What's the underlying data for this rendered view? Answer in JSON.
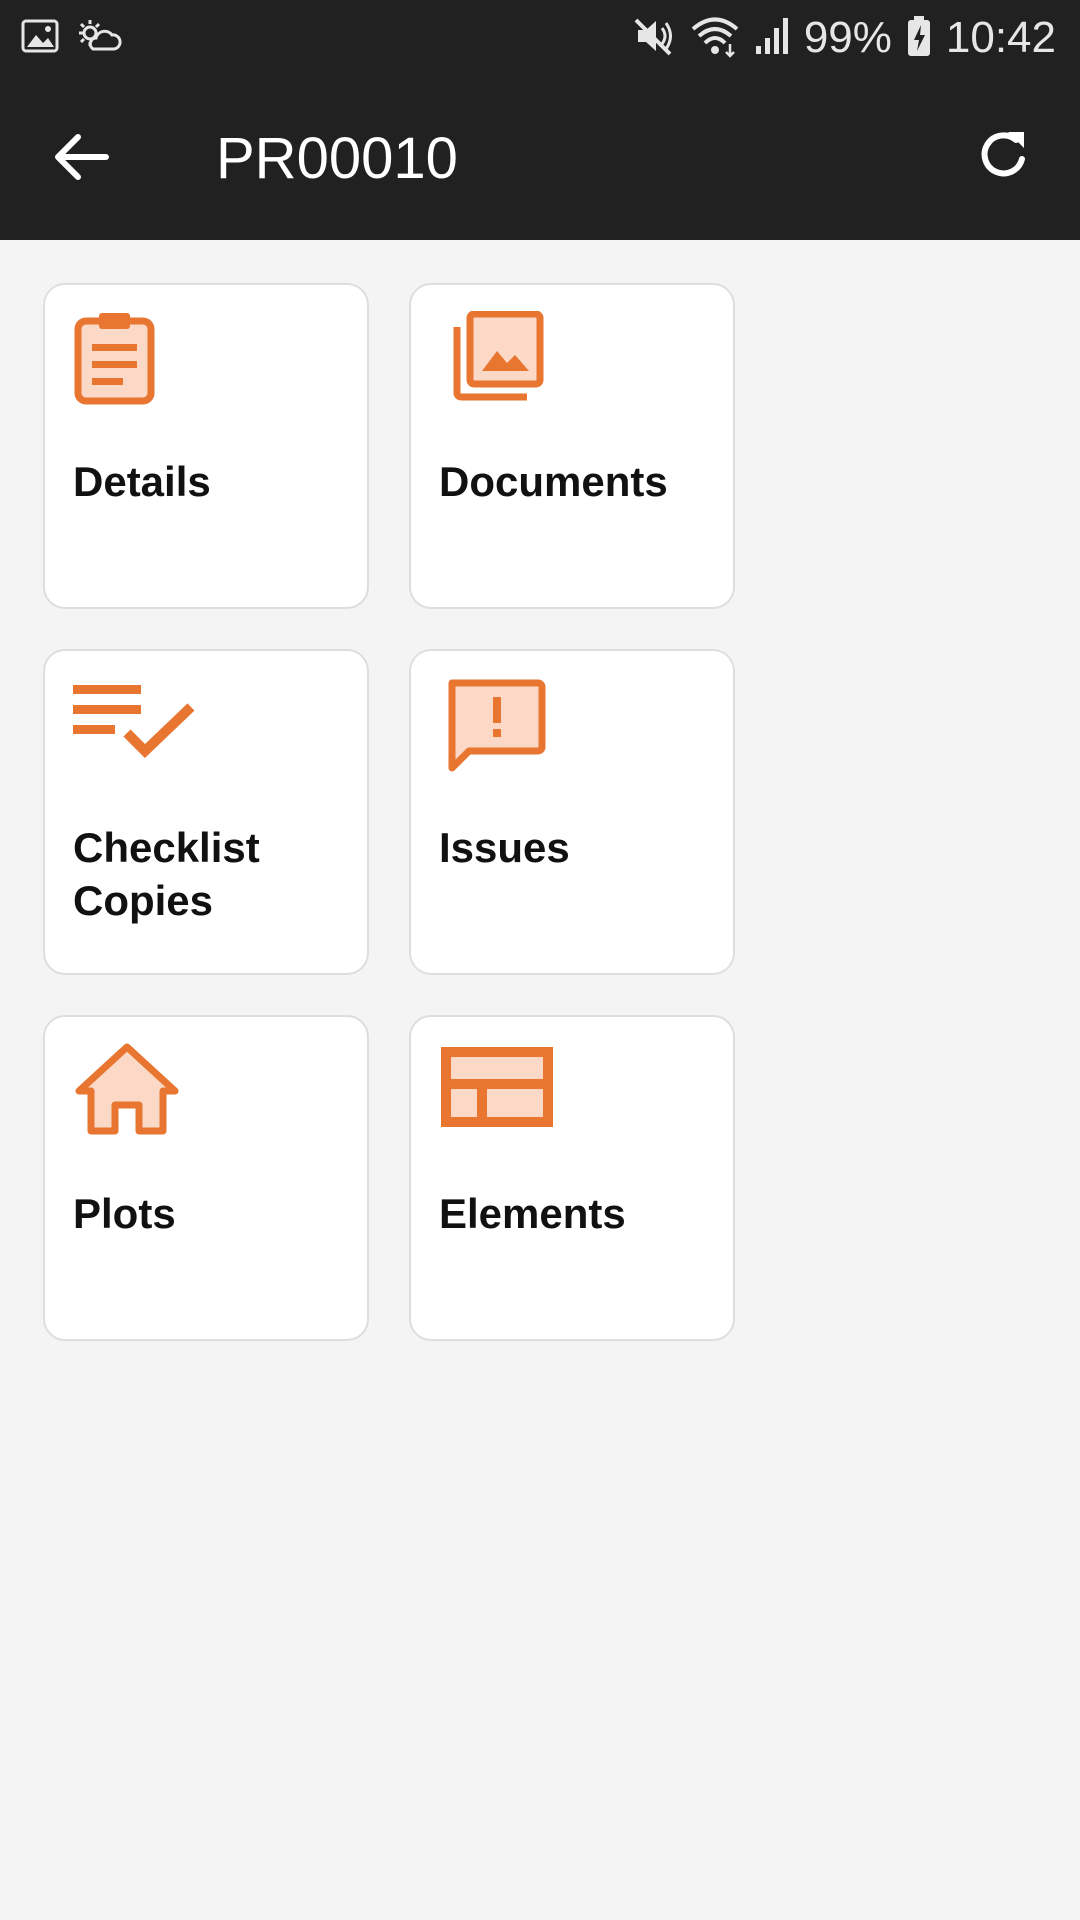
{
  "status_bar": {
    "battery": "99%",
    "time": "10:42"
  },
  "app_bar": {
    "title": "PR00010"
  },
  "tiles": [
    {
      "label": "Details",
      "icon": "clipboard-icon"
    },
    {
      "label": "Documents",
      "icon": "photo-library-icon"
    },
    {
      "label": "Checklist Copies",
      "icon": "checklist-icon"
    },
    {
      "label": "Issues",
      "icon": "alert-message-icon"
    },
    {
      "label": "Plots",
      "icon": "house-icon"
    },
    {
      "label": "Elements",
      "icon": "layout-icon"
    }
  ],
  "colors": {
    "accent": "#e87530",
    "accent_light": "#fbd9c6",
    "bar_bg": "#212121",
    "page_bg": "#f4f4f4"
  }
}
